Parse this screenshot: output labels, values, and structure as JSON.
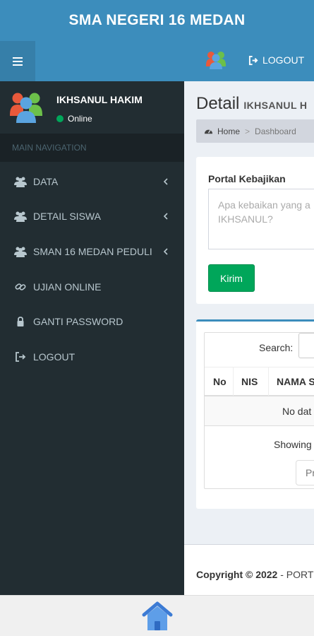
{
  "app": {
    "title": "SMA NEGERI 16 MEDAN"
  },
  "header": {
    "logout_label": "LOGOUT"
  },
  "user": {
    "name": "IKHSANUL HAKIM",
    "status": "Online"
  },
  "sidebar": {
    "nav_header": "MAIN NAVIGATION",
    "items": [
      {
        "label": "DATA",
        "icon": "users-icon",
        "has_submenu": true
      },
      {
        "label": "DETAIL SISWA",
        "icon": "users-icon",
        "has_submenu": true
      },
      {
        "label": "SMAN 16 MEDAN PEDULI",
        "icon": "users-icon",
        "has_submenu": true
      },
      {
        "label": "UJIAN ONLINE",
        "icon": "chain-link-icon",
        "has_submenu": false
      },
      {
        "label": "GANTI PASSWORD",
        "icon": "lock-icon",
        "has_submenu": false
      },
      {
        "label": "LOGOUT",
        "icon": "sign-out-icon",
        "has_submenu": false
      }
    ]
  },
  "page": {
    "title": "Detail",
    "subtitle": "IKHSANUL H",
    "breadcrumb": {
      "home": "Home",
      "current": "Dashboard"
    }
  },
  "portal": {
    "label": "Portal Kebajikan",
    "placeholder": "Apa kebaikan yang a\nIKHSANUL?",
    "submit_label": "Kirim"
  },
  "table": {
    "search_label": "Search:",
    "columns": [
      "No",
      "NIS",
      "NAMA S"
    ],
    "empty_text": "No dat",
    "info_text": "Showing",
    "paginate_text": "Pr"
  },
  "footer": {
    "copyright": "Copyright © 2022",
    "suffix": " - PORT"
  },
  "colors": {
    "primary": "#3c8dbc",
    "sidebar": "#222d32",
    "success": "#00a65a"
  }
}
